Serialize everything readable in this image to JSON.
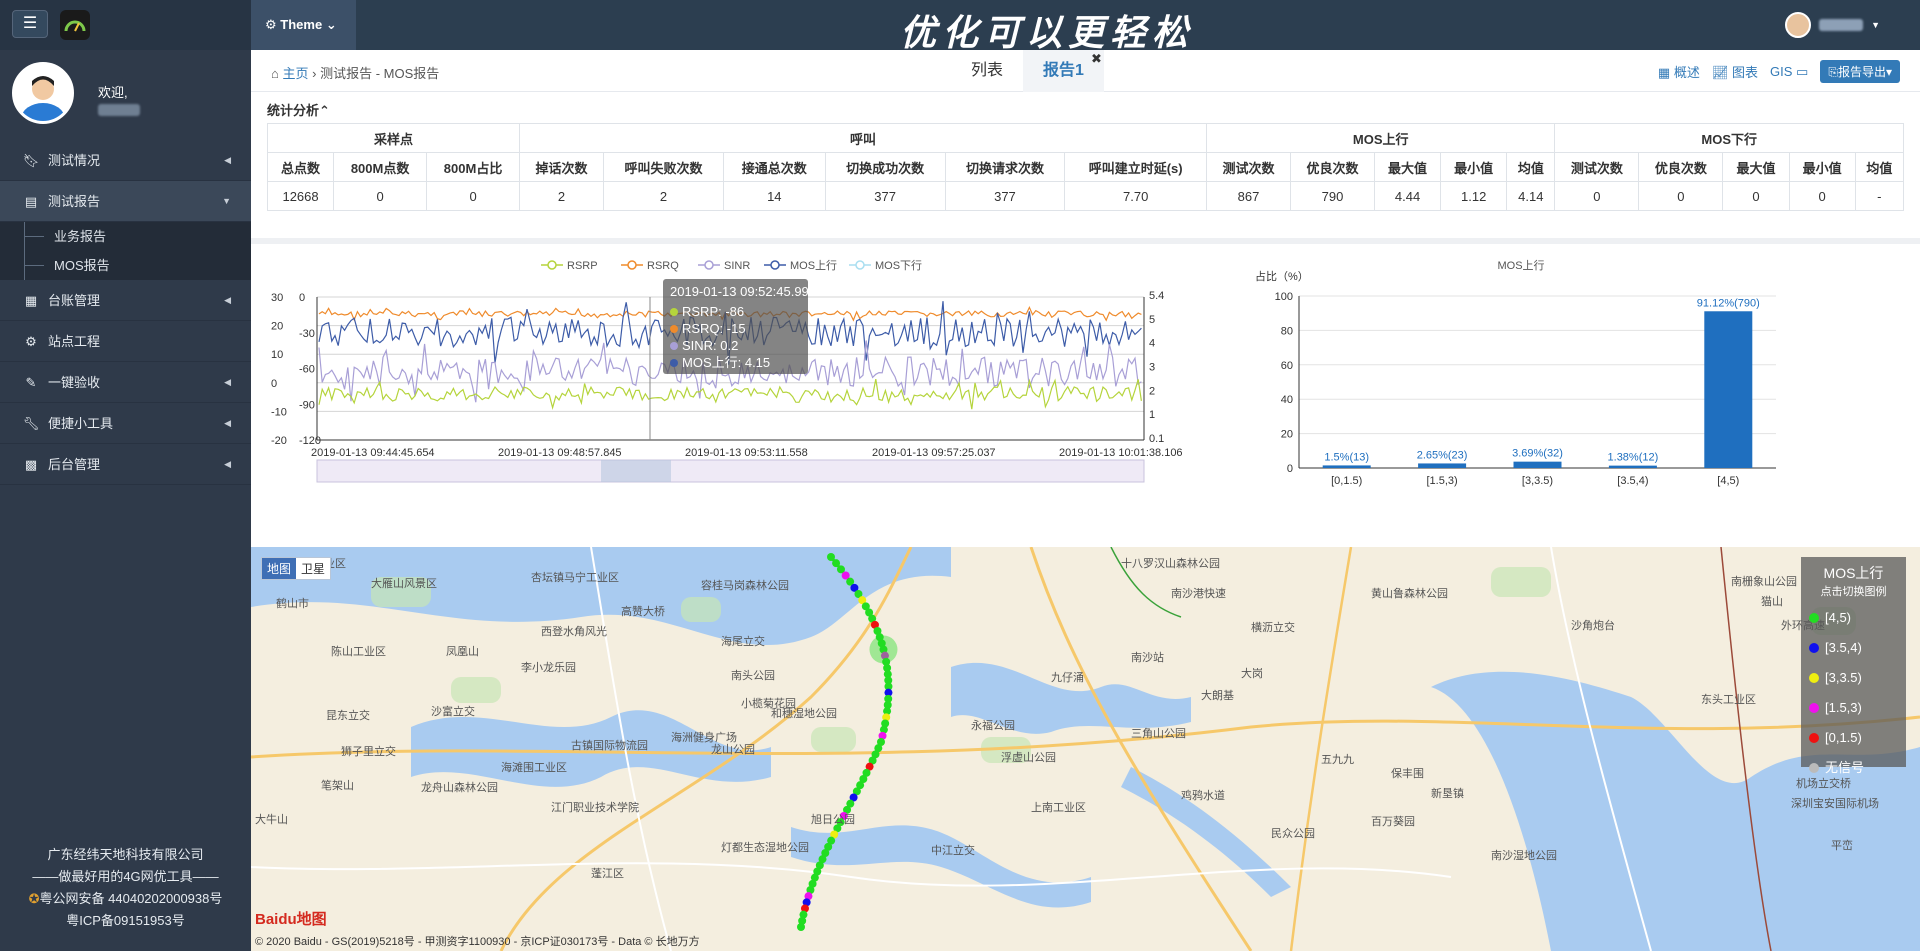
{
  "topbar": {
    "slogan": "优化可以更轻松",
    "theme_label": "Theme"
  },
  "sidebar": {
    "welcome": "欢迎,",
    "items": [
      {
        "label": "测试情况",
        "icon": "bookmark-icon",
        "caret": "◀"
      },
      {
        "label": "测试报告",
        "icon": "list-icon",
        "caret": "▼"
      },
      {
        "label": "台账管理",
        "icon": "table-icon",
        "caret": "◀"
      },
      {
        "label": "站点工程",
        "icon": "gears-icon",
        "caret": ""
      },
      {
        "label": "一键验收",
        "icon": "edit-icon",
        "caret": "◀"
      },
      {
        "label": "便捷小工具",
        "icon": "wrench-icon",
        "caret": "◀"
      },
      {
        "label": "后台管理",
        "icon": "grid-icon",
        "caret": "◀"
      }
    ],
    "sub_items": [
      "业务报告",
      "MOS报告"
    ],
    "footer": {
      "company": "广东经纬天地科技有限公司",
      "tagline": "——做最好用的4G网优工具——",
      "police": "粤公网安备 44040202000938号",
      "icp": "粤ICP备09151953号"
    }
  },
  "header": {
    "breadcrumb_home": "主页",
    "breadcrumb_current": "测试报告 - MOS报告",
    "tabs": [
      {
        "label": "列表",
        "active": false
      },
      {
        "label": "报告1",
        "active": true,
        "close": "✖"
      }
    ],
    "tools": [
      "概述",
      "图表",
      "GIS"
    ],
    "export_label": "报告导出"
  },
  "stats": {
    "title": "统计分析",
    "groups": [
      "采样点",
      "呼叫",
      "MOS上行",
      "MOS下行"
    ],
    "columns": [
      "总点数",
      "800M点数",
      "800M占比",
      "掉话次数",
      "呼叫失败次数",
      "接通总次数",
      "切换成功次数",
      "切换请求次数",
      "呼叫建立时延(s)",
      "测试次数",
      "优良次数",
      "最大值",
      "最小值",
      "均值",
      "测试次数",
      "优良次数",
      "最大值",
      "最小值",
      "均值"
    ],
    "values": [
      "12668",
      "0",
      "0",
      "2",
      "2",
      "14",
      "377",
      "377",
      "7.70",
      "867",
      "790",
      "4.44",
      "1.12",
      "4.14",
      "0",
      "0",
      "0",
      "0",
      "-"
    ]
  },
  "line_chart": {
    "legend": [
      "RSRP",
      "RSRQ",
      "SINR",
      "MOS上行",
      "MOS下行"
    ],
    "x_ticks": [
      "2019-01-13 09:44:45.654",
      "2019-01-13 09:48:57.845",
      "2019-01-13 09:53:11.558",
      "2019-01-13 09:57:25.037",
      "2019-01-13 10:01:38.106"
    ],
    "y_left1_ticks": [
      "30",
      "20",
      "10",
      "0",
      "-10",
      "-20"
    ],
    "y_left2_ticks": [
      "0",
      "-30",
      "-60",
      "-90",
      "-120"
    ],
    "y_right_ticks": [
      "5.4",
      "5",
      "4",
      "3",
      "2",
      "1",
      "0.1"
    ],
    "tooltip": {
      "time": "2019-01-13 09:52:45.997",
      "rows": [
        "RSRP: -86",
        "RSRQ: -15",
        "SINR: 0.2",
        "MOS上行: 4.15"
      ]
    },
    "colors": {
      "rsrp": "#b5d43c",
      "rsrq": "#ef8b2c",
      "sinr": "#a89fd6",
      "mos_up": "#3d5ca8",
      "mos_down": "#a9def0"
    }
  },
  "chart_data": {
    "type": "bar",
    "title": "MOS上行",
    "ylabel": "占比（%）",
    "categories": [
      "[0,1.5)",
      "[1.5,3)",
      "[3,3.5)",
      "[3.5,4)",
      "[4,5)"
    ],
    "values": [
      1.5,
      2.65,
      3.69,
      1.38,
      91.12
    ],
    "labels": [
      "1.5%(13)",
      "2.65%(23)",
      "3.69%(32)",
      "1.38%(12)",
      "91.12%(790)"
    ],
    "y_ticks": [
      "0",
      "20",
      "40",
      "60",
      "80",
      "100"
    ],
    "ylim": [
      0,
      100
    ],
    "color": "#1f6fbf"
  },
  "map": {
    "toggle": [
      "地图",
      "卫星"
    ],
    "legend_title": "MOS上行",
    "legend_sub": "点击切换图例",
    "legend_items": [
      {
        "label": "[4,5)",
        "color": "#22dd22"
      },
      {
        "label": "[3.5,4)",
        "color": "#1010ee"
      },
      {
        "label": "[3,3.5)",
        "color": "#eeee11"
      },
      {
        "label": "[1.5,3)",
        "color": "#ee11ee"
      },
      {
        "label": "[0,1.5)",
        "color": "#ee1111"
      },
      {
        "label": "无信号",
        "color": "#bbbbbb"
      }
    ],
    "places": [
      "南朗工业区",
      "杏坛镇马宁工业区",
      "容桂马岗森林公园",
      "大雁山风景区",
      "鹤山市",
      "高赞大桥",
      "海尾立交",
      "西登水角风光",
      "陈山工业区",
      "凤凰山",
      "李小龙乐园",
      "南头公园",
      "沙富立交",
      "小榄菊花园",
      "和穗湿地公园",
      "昆东立交",
      "古镇国际物流园",
      "海洲健身广场",
      "海滩围工业区",
      "龙山公园",
      "狮子里立交",
      "笔架山",
      "龙舟山森林公园",
      "江门职业技术学院",
      "灯都生态湿地公园",
      "旭日公园",
      "中江立交",
      "大牛山",
      "蓬江区",
      "十八罗汉山森林公园",
      "南沙港快速",
      "横沥立交",
      "黄山鲁森林公园",
      "南沙站",
      "大岗",
      "永福公园",
      "三角山公园",
      "浮虚山公园",
      "上南工业区",
      "鸡鸦水道",
      "五九九",
      "保丰围",
      "新垦镇",
      "百万葵园",
      "南沙湿地公园",
      "民众公园",
      "南栅象山公园",
      "猫山",
      "外环高速",
      "沙角炮台",
      "东头工业区",
      "机场立交桥",
      "深圳宝安国际机场",
      "平峦",
      "九仔涌",
      "大朗基"
    ],
    "footer": "© 2020 Baidu - GS(2019)5218号 - 甲测资字1100930 - 京ICP证030173号 - Data © 长地万方",
    "baidu": "Baidu地图"
  }
}
